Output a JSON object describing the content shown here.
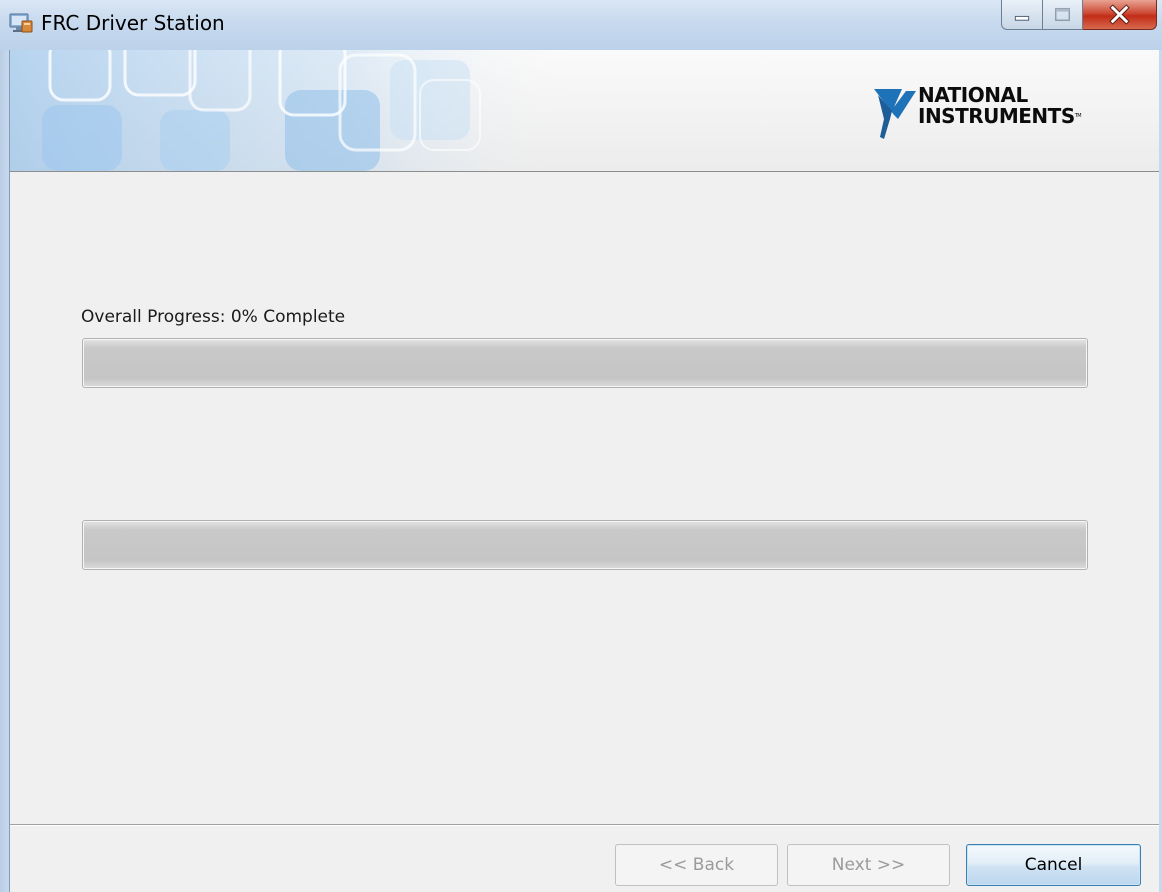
{
  "window": {
    "title": "FRC Driver Station",
    "controls": {
      "minimize_icon": "minimize-icon",
      "maximize_icon": "maximize-icon",
      "close_icon": "close-icon"
    }
  },
  "banner": {
    "logo_line1": "NATIONAL",
    "logo_line2": "INSTRUMENTS",
    "logo_mark": "TM",
    "brand_color": "#1e73b8"
  },
  "progress": {
    "overall_label": "Overall Progress: 0% Complete",
    "overall_fraction": 0,
    "secondary_fraction": 0
  },
  "buttons": {
    "back_label": "<< Back",
    "next_label": "Next >>",
    "cancel_label": "Cancel",
    "back_enabled": false,
    "next_enabled": false
  }
}
